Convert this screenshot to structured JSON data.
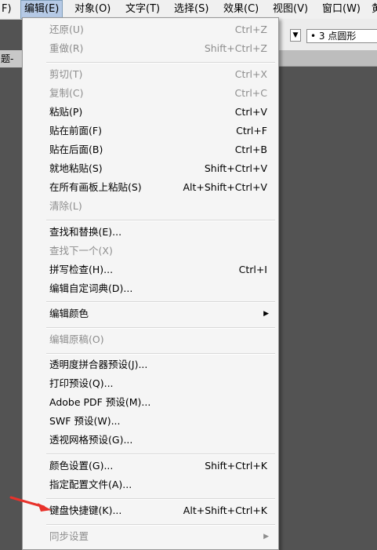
{
  "menubar": {
    "items": [
      "F)",
      "编辑(E)",
      "对象(O)",
      "文字(T)",
      "选择(S)",
      "效果(C)",
      "视图(V)",
      "窗口(W)",
      "黄"
    ]
  },
  "control": {
    "brush_value": "• 3 点圆形",
    "dd_arrow": "▼"
  },
  "doc_tab": {
    "title": "题-"
  },
  "menu": {
    "items": [
      {
        "label": "还原(U)",
        "shortcut": "Ctrl+Z",
        "disabled": true
      },
      {
        "label": "重做(R)",
        "shortcut": "Shift+Ctrl+Z",
        "disabled": true
      },
      {
        "label": "剪切(T)",
        "shortcut": "Ctrl+X",
        "disabled": true
      },
      {
        "label": "复制(C)",
        "shortcut": "Ctrl+C",
        "disabled": true
      },
      {
        "label": "粘贴(P)",
        "shortcut": "Ctrl+V",
        "disabled": false
      },
      {
        "label": "贴在前面(F)",
        "shortcut": "Ctrl+F",
        "disabled": false
      },
      {
        "label": "贴在后面(B)",
        "shortcut": "Ctrl+B",
        "disabled": false
      },
      {
        "label": "就地粘贴(S)",
        "shortcut": "Shift+Ctrl+V",
        "disabled": false
      },
      {
        "label": "在所有画板上粘贴(S)",
        "shortcut": "Alt+Shift+Ctrl+V",
        "disabled": false
      },
      {
        "label": "清除(L)",
        "shortcut": "",
        "disabled": true
      },
      {
        "label": "查找和替换(E)...",
        "shortcut": "",
        "disabled": false
      },
      {
        "label": "查找下一个(X)",
        "shortcut": "",
        "disabled": true
      },
      {
        "label": "拼写检查(H)...",
        "shortcut": "Ctrl+I",
        "disabled": false
      },
      {
        "label": "编辑自定词典(D)...",
        "shortcut": "",
        "disabled": false
      },
      {
        "label": "编辑颜色",
        "shortcut": "",
        "disabled": false,
        "submenu": true
      },
      {
        "label": "编辑原稿(O)",
        "shortcut": "",
        "disabled": true
      },
      {
        "label": "透明度拼合器预设(J)...",
        "shortcut": "",
        "disabled": false
      },
      {
        "label": "打印预设(Q)...",
        "shortcut": "",
        "disabled": false
      },
      {
        "label": "Adobe PDF 预设(M)...",
        "shortcut": "",
        "disabled": false
      },
      {
        "label": "SWF 预设(W)...",
        "shortcut": "",
        "disabled": false
      },
      {
        "label": "透视网格预设(G)...",
        "shortcut": "",
        "disabled": false
      },
      {
        "label": "颜色设置(G)...",
        "shortcut": "Shift+Ctrl+K",
        "disabled": false
      },
      {
        "label": "指定配置文件(A)...",
        "shortcut": "",
        "disabled": false
      },
      {
        "label": "键盘快捷键(K)...",
        "shortcut": "Alt+Shift+Ctrl+K",
        "disabled": false
      },
      {
        "label": "同步设置",
        "shortcut": "",
        "disabled": true,
        "submenu": true
      }
    ],
    "submenu_arrow": "▶"
  },
  "colors": {
    "menubar_bg": "#f0f0f0",
    "menu_bg": "#f5f5f5",
    "active_menu_bg": "#b5c9e5",
    "disabled_text": "#8d8d8d",
    "annotation_arrow": "#e8322b"
  },
  "icons": {
    "submenu": "chevron-right-icon",
    "dropdown": "chevron-down-icon",
    "annotation": "red-arrow-icon"
  }
}
